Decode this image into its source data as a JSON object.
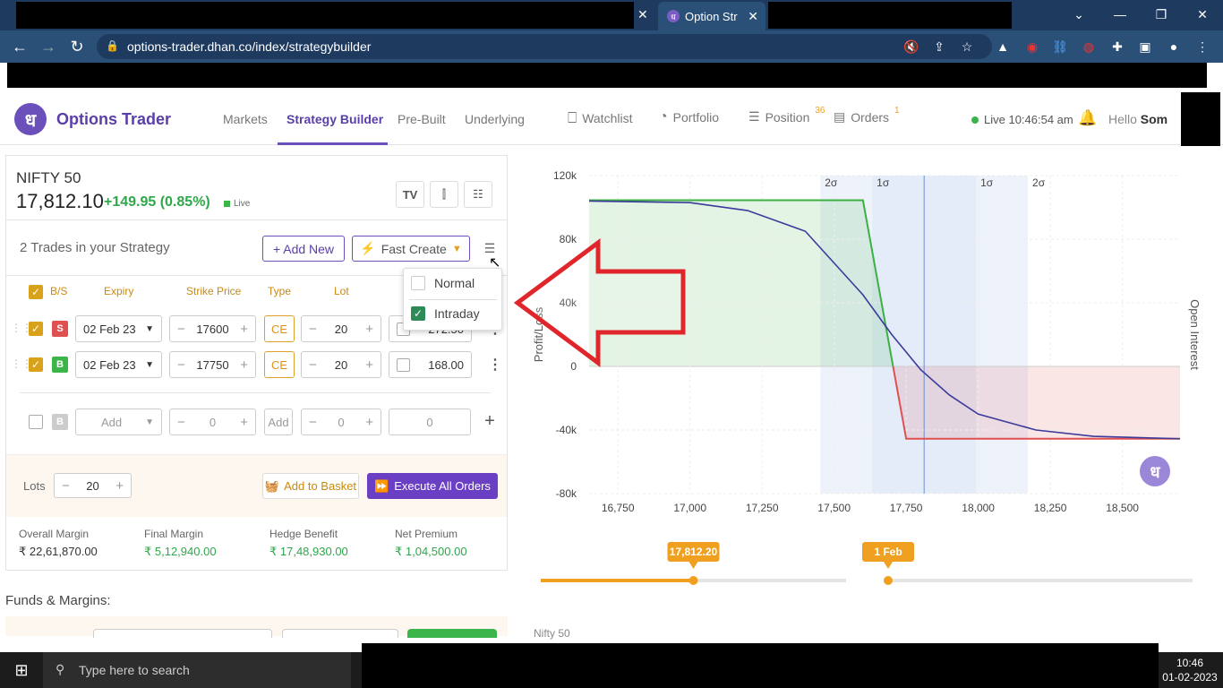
{
  "browser": {
    "active_tab_title": "Option Str",
    "url": "options-trader.dhan.co/index/strategybuilder"
  },
  "header": {
    "logo_text": "Options Trader",
    "nav": [
      "Markets",
      "Strategy Builder",
      "Pre-Built",
      "Underlying"
    ],
    "watchlist": "Watchlist",
    "portfolio": "Portfolio",
    "position": "Position",
    "position_count": "36",
    "orders": "Orders",
    "orders_count": "1",
    "live_time": "Live 10:46:54 am",
    "hello": "Hello",
    "user": "Som"
  },
  "underlying": {
    "name": "NIFTY 50",
    "price": "17,812.10",
    "change": "+149.95 (0.85%)",
    "live": "Live"
  },
  "strategy": {
    "trades_count": "2 Trades in your Strategy",
    "add_new": "+ Add New",
    "fast_create": "Fast Create",
    "columns": [
      "B/S",
      "Expiry",
      "Strike Price",
      "Type",
      "Lot"
    ],
    "rows": [
      {
        "side": "S",
        "expiry": "02 Feb 23",
        "strike": "17600",
        "type": "CE",
        "lot": "20",
        "price": "272.50"
      },
      {
        "side": "B",
        "expiry": "02 Feb 23",
        "strike": "17750",
        "type": "CE",
        "lot": "20",
        "price": "168.00"
      }
    ],
    "empty_row": {
      "side": "B",
      "expiry": "Add",
      "strike": "0",
      "type": "Add",
      "lot": "0",
      "price": "0"
    }
  },
  "dropdown": {
    "normal": "Normal",
    "intraday": "Intraday"
  },
  "footer": {
    "lots_label": "Lots",
    "lots_value": "20",
    "add_to_basket": "Add to Basket",
    "execute": "Execute All Orders",
    "overall_margin_label": "Overall Margin",
    "overall_margin": "₹ 22,61,870.00",
    "final_margin_label": "Final Margin",
    "final_margin": "₹ 5,12,940.00",
    "hedge_benefit_label": "Hedge Benefit",
    "hedge_benefit": "₹ 17,48,930.00",
    "net_premium_label": "Net Premium",
    "net_premium": "₹ 1,04,500.00"
  },
  "funds_title": "Funds & Margins:",
  "chart_data": {
    "type": "line",
    "ylabel": "Profit/Loss",
    "y2label": "Open Interest",
    "xlim": [
      16650,
      18700
    ],
    "ylim": [
      -80000,
      120000
    ],
    "x_ticks": [
      "16,750",
      "17,000",
      "17,250",
      "17,500",
      "17,750",
      "18,000",
      "18,250",
      "18,500"
    ],
    "y_ticks": [
      "120k",
      "80k",
      "40k",
      "0",
      "-40k",
      "-80k"
    ],
    "sigma_labels": [
      "2σ",
      "1σ",
      "1σ",
      "2σ"
    ],
    "spot": 17812.2,
    "series": [
      {
        "color": "#3cb043",
        "x": [
          16650,
          17600,
          17750,
          18700
        ],
        "y": [
          104500,
          104500,
          -45500,
          -45500
        ]
      },
      {
        "color": "#3b3b9b",
        "x": [
          16650,
          17000,
          17200,
          17400,
          17600,
          17700,
          17800,
          17900,
          18000,
          18200,
          18400,
          18700
        ],
        "y": [
          104000,
          103000,
          98000,
          85000,
          45000,
          20000,
          -2000,
          -18000,
          -30000,
          -40000,
          -44000,
          -45500
        ]
      }
    ]
  },
  "sliders": {
    "spot_label": "17,812.20",
    "date_label": "1 Feb",
    "spot_fraction": 0.5
  },
  "bottom_label": "Nifty 50",
  "taskbar": {
    "search": "Type here to search",
    "time": "10:46",
    "date": "01-02-2023"
  }
}
